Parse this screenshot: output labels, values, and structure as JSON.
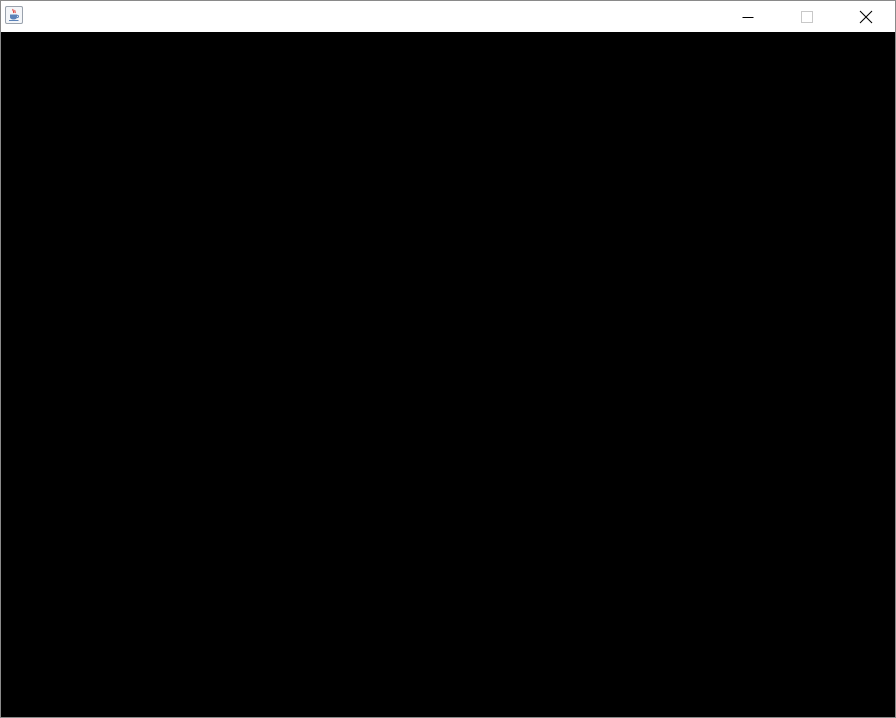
{
  "window": {
    "title": "",
    "icon": "java-coffee-cup-icon",
    "controls": {
      "minimize_icon": "minimize-icon",
      "maximize_icon": "maximize-icon",
      "maximize_state": "disabled",
      "close_icon": "close-icon"
    },
    "colors": {
      "titlebar": "#ffffff",
      "content": "#000000",
      "border": "#8a8a8a",
      "disabled_control": "#c8c8c8"
    }
  }
}
